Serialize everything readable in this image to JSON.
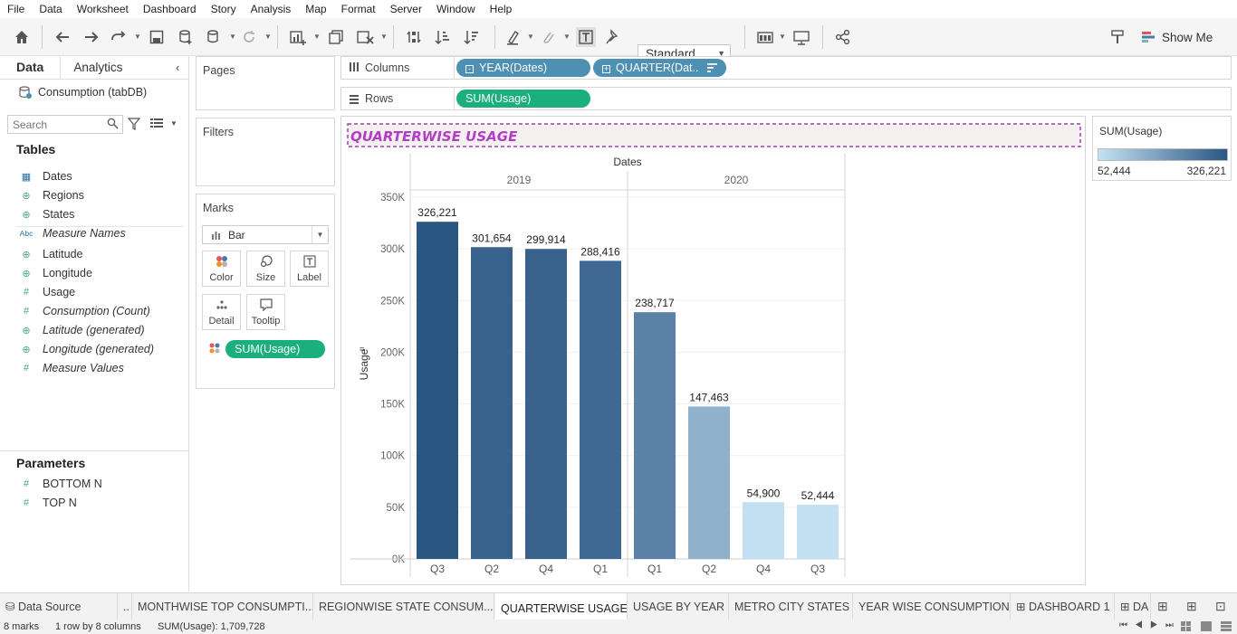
{
  "menu": [
    "File",
    "Data",
    "Worksheet",
    "Dashboard",
    "Story",
    "Analysis",
    "Map",
    "Format",
    "Server",
    "Window",
    "Help"
  ],
  "toolbar": {
    "fit_mode": "Standard",
    "show_me": "Show Me"
  },
  "left_panel": {
    "tab_data": "Data",
    "tab_analytics": "Analytics",
    "datasource": "Consumption (tabDB)",
    "search_placeholder": "Search",
    "tables_heading": "Tables",
    "fields": [
      {
        "label": "Dates",
        "icon": "calendar-icon",
        "italic": false
      },
      {
        "label": "Regions",
        "icon": "globe-icon",
        "italic": false
      },
      {
        "label": "States",
        "icon": "globe-icon",
        "italic": false
      },
      {
        "label": "Measure Names",
        "icon": "abc-icon",
        "italic": true
      },
      {
        "label": "Latitude",
        "icon": "globe-icon",
        "italic": false
      },
      {
        "label": "Longitude",
        "icon": "globe-icon",
        "italic": false
      },
      {
        "label": "Usage",
        "icon": "hash-icon",
        "italic": false
      },
      {
        "label": "Consumption (Count)",
        "icon": "hash-icon",
        "italic": true
      },
      {
        "label": "Latitude (generated)",
        "icon": "globe-icon",
        "italic": true
      },
      {
        "label": "Longitude (generated)",
        "icon": "globe-icon",
        "italic": true
      },
      {
        "label": "Measure Values",
        "icon": "hash-icon",
        "italic": true
      }
    ],
    "parameters_heading": "Parameters",
    "parameters": [
      "BOTTOM N",
      "TOP N"
    ]
  },
  "shelves": {
    "pages": "Pages",
    "filters": "Filters",
    "marks": "Marks",
    "mark_type": "Bar",
    "mark_buttons": [
      "Color",
      "Size",
      "Label",
      "Detail",
      "Tooltip"
    ],
    "marks_pill": "SUM(Usage)",
    "columns_label": "Columns",
    "rows_label": "Rows",
    "columns_pills": [
      "YEAR(Dates)",
      "QUARTER(Dat.."
    ],
    "rows_pills": [
      "SUM(Usage)"
    ]
  },
  "sheet_title": "QUARTERWISE USAGE",
  "legend": {
    "title": "SUM(Usage)",
    "min": "52,444",
    "max": "326,221",
    "color_min": "#c4e1f3",
    "color_max": "#2a5682"
  },
  "chart_data": {
    "type": "bar",
    "title": "QUARTERWISE USAGE",
    "xlabel": "Dates",
    "ylabel": "Usage",
    "groups": [
      {
        "year": "2019",
        "categories": [
          "Q3",
          "Q2",
          "Q4",
          "Q1"
        ],
        "values": [
          326221,
          301654,
          299914,
          288416
        ],
        "labels": [
          "326,221",
          "301,654",
          "299,914",
          "288,416"
        ]
      },
      {
        "year": "2020",
        "categories": [
          "Q1",
          "Q2",
          "Q4",
          "Q3"
        ],
        "values": [
          238717,
          147463,
          54900,
          52444
        ],
        "labels": [
          "238,717",
          "147,463",
          "54,900",
          "52,444"
        ]
      }
    ],
    "ylim": [
      0,
      350000
    ],
    "yticks": [
      0,
      50000,
      100000,
      150000,
      200000,
      250000,
      300000,
      350000
    ],
    "ytick_labels": [
      "0K",
      "50K",
      "100K",
      "150K",
      "200K",
      "250K",
      "300K",
      "350K"
    ],
    "grid": true,
    "legend": "right"
  },
  "bottom_tabs": [
    "Data Source",
    "..",
    "MONTHWISE TOP CONSUMPTI...",
    "REGIONWISE STATE CONSUM...",
    "QUARTERWISE USAGE",
    "USAGE  BY YEAR",
    "METRO CITY STATES",
    "YEAR WISE CONSUMPTION",
    "DASHBOARD 1",
    "DA"
  ],
  "status": {
    "marks": "8 marks",
    "rows_cols": "1 row by 8 columns",
    "sum": "SUM(Usage): 1,709,728"
  }
}
